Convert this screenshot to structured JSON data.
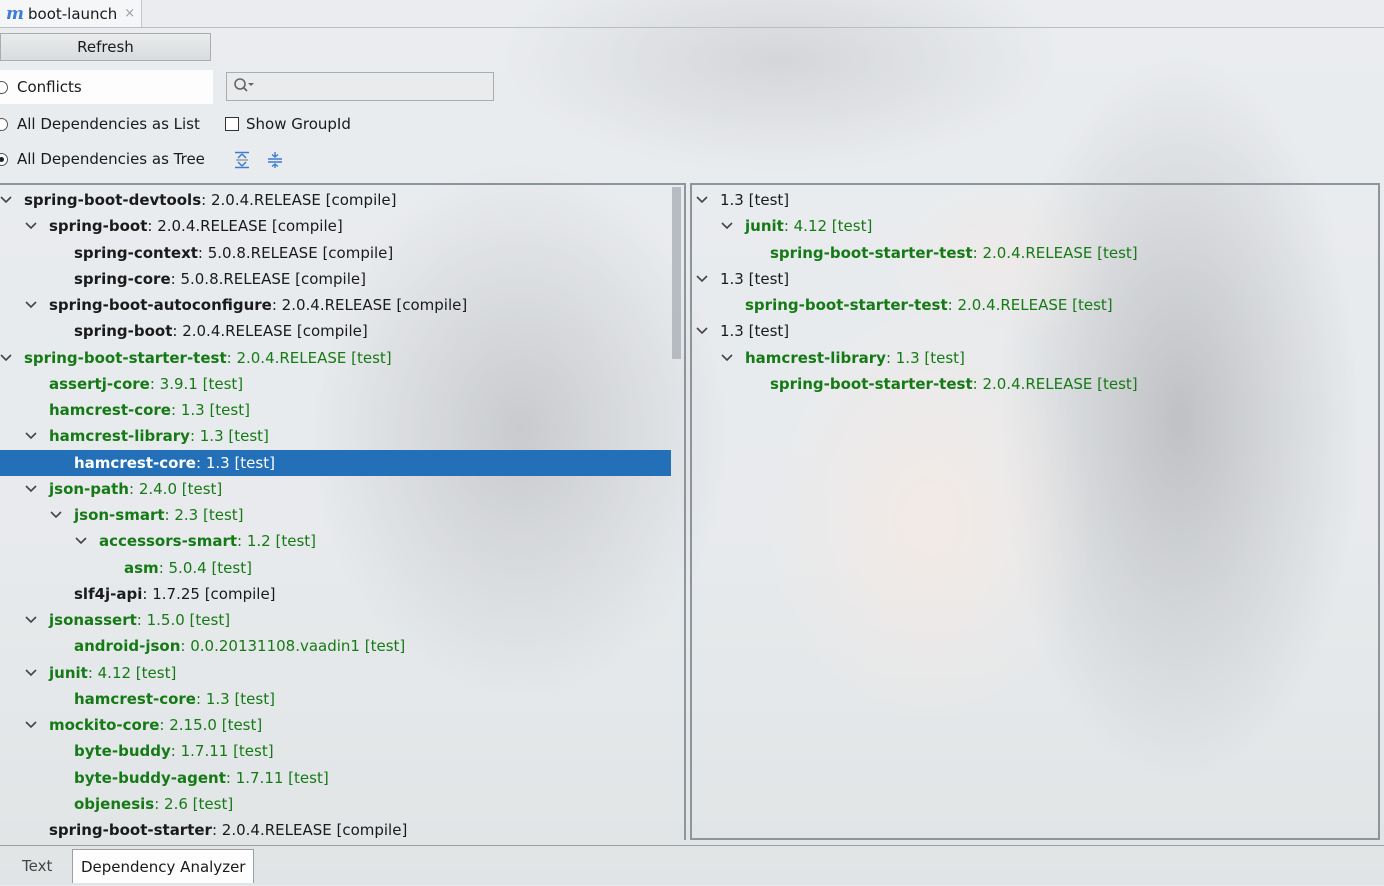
{
  "editor_tab": {
    "icon": "m",
    "label": "boot-launch",
    "close": "×"
  },
  "toolbar": {
    "refresh_label": "Refresh",
    "search_placeholder": "",
    "modes": [
      {
        "label": "Conflicts",
        "selected": false
      },
      {
        "label": "All Dependencies as List",
        "selected": false
      },
      {
        "label": "All Dependencies as Tree",
        "selected": true
      }
    ],
    "show_groupid_label": "Show GroupId",
    "show_groupid_checked": false
  },
  "left_tree": [
    {
      "depth": 0,
      "expanded": true,
      "artifact": "spring-boot-devtools",
      "rest": " : 2.0.4.RELEASE [compile]",
      "scope": "compile"
    },
    {
      "depth": 1,
      "expanded": true,
      "artifact": "spring-boot",
      "rest": " : 2.0.4.RELEASE [compile]",
      "scope": "compile"
    },
    {
      "depth": 2,
      "expanded": null,
      "artifact": "spring-context",
      "rest": " : 5.0.8.RELEASE [compile]",
      "scope": "compile"
    },
    {
      "depth": 2,
      "expanded": null,
      "artifact": "spring-core",
      "rest": " : 5.0.8.RELEASE [compile]",
      "scope": "compile"
    },
    {
      "depth": 1,
      "expanded": true,
      "artifact": "spring-boot-autoconfigure",
      "rest": " : 2.0.4.RELEASE [compile]",
      "scope": "compile"
    },
    {
      "depth": 2,
      "expanded": null,
      "artifact": "spring-boot",
      "rest": " : 2.0.4.RELEASE [compile]",
      "scope": "compile"
    },
    {
      "depth": 0,
      "expanded": true,
      "artifact": "spring-boot-starter-test",
      "rest": " : 2.0.4.RELEASE [test]",
      "scope": "test"
    },
    {
      "depth": 1,
      "expanded": null,
      "artifact": "assertj-core",
      "rest": " : 3.9.1 [test]",
      "scope": "test"
    },
    {
      "depth": 1,
      "expanded": null,
      "artifact": "hamcrest-core",
      "rest": " : 1.3 [test]",
      "scope": "test"
    },
    {
      "depth": 1,
      "expanded": true,
      "artifact": "hamcrest-library",
      "rest": " : 1.3 [test]",
      "scope": "test"
    },
    {
      "depth": 2,
      "expanded": null,
      "artifact": "hamcrest-core",
      "rest": " : 1.3 [test]",
      "scope": "test",
      "selected": true
    },
    {
      "depth": 1,
      "expanded": true,
      "artifact": "json-path",
      "rest": " : 2.4.0 [test]",
      "scope": "test"
    },
    {
      "depth": 2,
      "expanded": true,
      "artifact": "json-smart",
      "rest": " : 2.3 [test]",
      "scope": "test"
    },
    {
      "depth": 3,
      "expanded": true,
      "artifact": "accessors-smart",
      "rest": " : 1.2 [test]",
      "scope": "test"
    },
    {
      "depth": 4,
      "expanded": null,
      "artifact": "asm",
      "rest": " : 5.0.4 [test]",
      "scope": "test"
    },
    {
      "depth": 2,
      "expanded": null,
      "artifact": "slf4j-api",
      "rest": " : 1.7.25 [compile]",
      "scope": "compile"
    },
    {
      "depth": 1,
      "expanded": true,
      "artifact": "jsonassert",
      "rest": " : 1.5.0 [test]",
      "scope": "test"
    },
    {
      "depth": 2,
      "expanded": null,
      "artifact": "android-json",
      "rest": " : 0.0.20131108.vaadin1 [test]",
      "scope": "test"
    },
    {
      "depth": 1,
      "expanded": true,
      "artifact": "junit",
      "rest": " : 4.12 [test]",
      "scope": "test"
    },
    {
      "depth": 2,
      "expanded": null,
      "artifact": "hamcrest-core",
      "rest": " : 1.3 [test]",
      "scope": "test"
    },
    {
      "depth": 1,
      "expanded": true,
      "artifact": "mockito-core",
      "rest": " : 2.15.0 [test]",
      "scope": "test"
    },
    {
      "depth": 2,
      "expanded": null,
      "artifact": "byte-buddy",
      "rest": " : 1.7.11 [test]",
      "scope": "test"
    },
    {
      "depth": 2,
      "expanded": null,
      "artifact": "byte-buddy-agent",
      "rest": " : 1.7.11 [test]",
      "scope": "test"
    },
    {
      "depth": 2,
      "expanded": null,
      "artifact": "objenesis",
      "rest": " : 2.6 [test]",
      "scope": "test"
    },
    {
      "depth": 1,
      "expanded": null,
      "artifact": "spring-boot-starter",
      "rest": " : 2.0.4.RELEASE [compile]",
      "scope": "compile"
    }
  ],
  "right_tree": [
    {
      "depth": 0,
      "expanded": true,
      "artifact": "",
      "rest": "1.3 [test]",
      "scope": "plain"
    },
    {
      "depth": 1,
      "expanded": true,
      "artifact": "junit",
      "rest": " : 4.12 [test]",
      "scope": "test"
    },
    {
      "depth": 2,
      "expanded": null,
      "artifact": "spring-boot-starter-test",
      "rest": " : 2.0.4.RELEASE [test]",
      "scope": "test"
    },
    {
      "depth": 0,
      "expanded": true,
      "artifact": "",
      "rest": "1.3 [test]",
      "scope": "plain"
    },
    {
      "depth": 1,
      "expanded": null,
      "artifact": "spring-boot-starter-test",
      "rest": " : 2.0.4.RELEASE [test]",
      "scope": "test"
    },
    {
      "depth": 0,
      "expanded": true,
      "artifact": "",
      "rest": "1.3 [test]",
      "scope": "plain"
    },
    {
      "depth": 1,
      "expanded": true,
      "artifact": "hamcrest-library",
      "rest": " : 1.3 [test]",
      "scope": "test"
    },
    {
      "depth": 2,
      "expanded": null,
      "artifact": "spring-boot-starter-test",
      "rest": " : 2.0.4.RELEASE [test]",
      "scope": "test"
    }
  ],
  "bottom_tabs": {
    "text": "Text",
    "analyzer": "Dependency Analyzer"
  },
  "colors": {
    "test_scope": "#157a15",
    "compile_scope": "#1a1a1a",
    "selection": "#2470b8"
  }
}
